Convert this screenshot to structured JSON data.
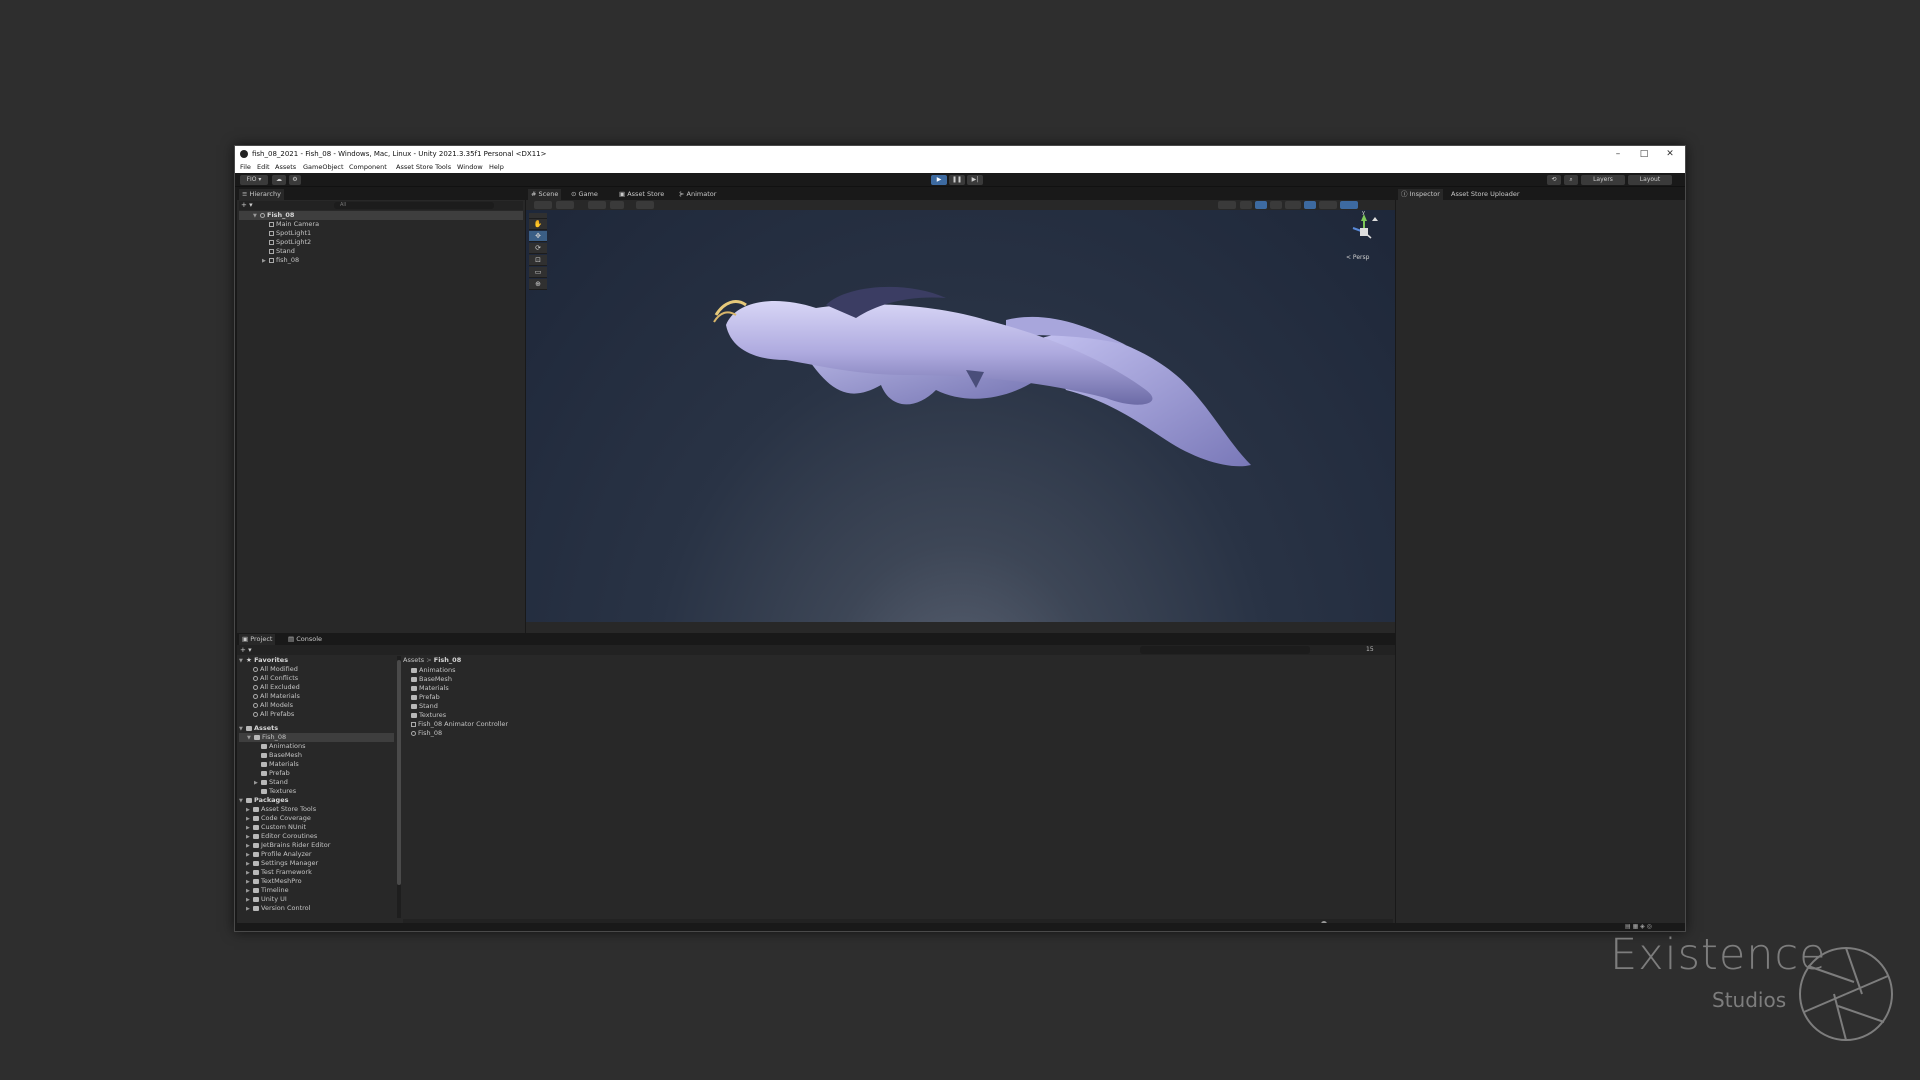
{
  "window": {
    "title": "fish_08_2021 - Fish_08 - Windows, Mac, Linux - Unity 2021.3.35f1 Personal <DX11>",
    "controls": [
      "–",
      "□",
      "✕"
    ]
  },
  "menu": [
    "File",
    "Edit",
    "Assets",
    "GameObject",
    "Component",
    "Asset Store Tools",
    "Window",
    "Help"
  ],
  "toolbar": {
    "account": "FIO ▾",
    "layers": "Layers",
    "layout": "Layout"
  },
  "hierarchy": {
    "tab": "Hierarchy",
    "search_placeholder": "All",
    "scene": "Fish_08",
    "items": [
      "Main Camera",
      "SpotLight1",
      "SpotLight2",
      "Stand",
      "fish_08"
    ]
  },
  "scene_tabs": [
    "Scene",
    "Game",
    "Asset Store",
    "Animator"
  ],
  "scene": {
    "persp": "< Persp",
    "gizmo_axis": "y"
  },
  "inspector_tabs": [
    "Inspector",
    "Asset Store Uploader"
  ],
  "project": {
    "tabs": [
      "Project",
      "Console"
    ],
    "favorites_label": "Favorites",
    "favorites": [
      "All Modified",
      "All Conflicts",
      "All Excluded",
      "All Materials",
      "All Models",
      "All Prefabs"
    ],
    "assets_label": "Assets",
    "assets_folder": "Fish_08",
    "assets_children": [
      "Animations",
      "BaseMesh",
      "Materials",
      "Prefab",
      "Stand",
      "Textures"
    ],
    "packages_label": "Packages",
    "packages": [
      "Asset Store Tools",
      "Code Coverage",
      "Custom NUnit",
      "Editor Coroutines",
      "JetBrains Rider Editor",
      "Profile Analyzer",
      "Settings Manager",
      "Test Framework",
      "TextMeshPro",
      "Timeline",
      "Unity UI",
      "Version Control"
    ],
    "breadcrumb": [
      "Assets",
      ">",
      "Fish_08"
    ],
    "contents": [
      {
        "name": "Animations",
        "icon": "folder-icon"
      },
      {
        "name": "BaseMesh",
        "icon": "folder-icon"
      },
      {
        "name": "Materials",
        "icon": "folder-icon"
      },
      {
        "name": "Prefab",
        "icon": "folder-icon"
      },
      {
        "name": "Stand",
        "icon": "folder-icon"
      },
      {
        "name": "Textures",
        "icon": "folder-icon"
      },
      {
        "name": "Fish_08 Animator Controller",
        "icon": "animator-controller-icon"
      },
      {
        "name": "Fish_08",
        "icon": "scene-icon"
      }
    ],
    "hidden_count": "15"
  },
  "watermark": {
    "line1": "Existence",
    "line2": "Studios"
  },
  "colors": {
    "play_accent": "#4a8ad4",
    "selection": "#3e5f8a",
    "fish_body": "#b9b6e8"
  }
}
